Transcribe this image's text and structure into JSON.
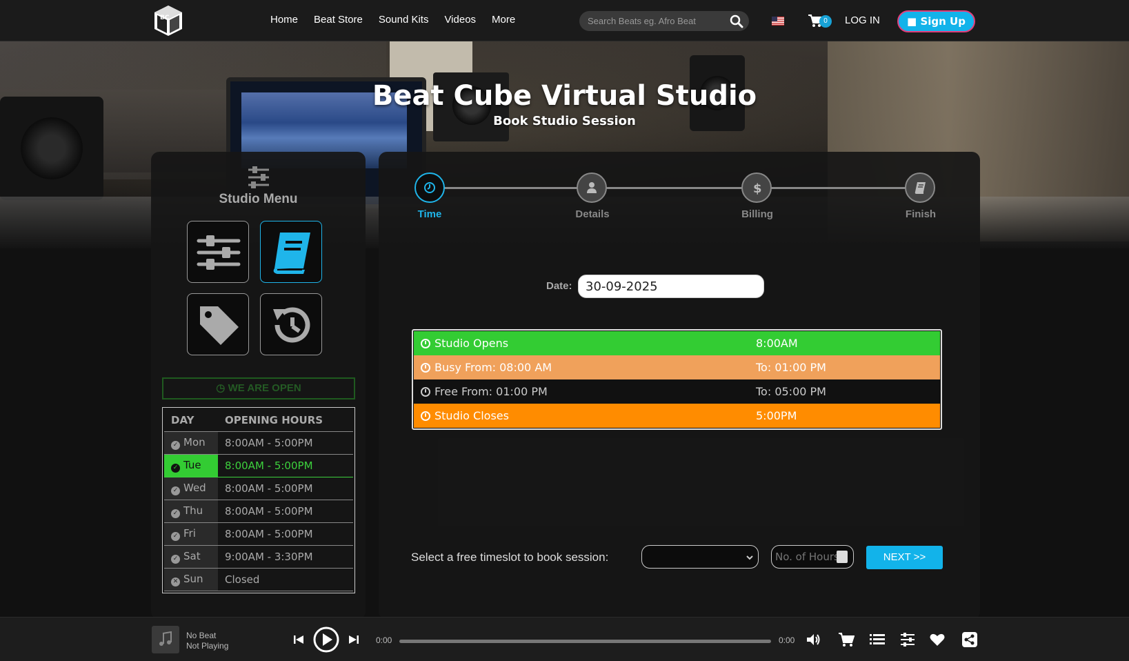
{
  "header": {
    "logo_alt": "BC",
    "nav": [
      "Home",
      "Beat Store",
      "Sound Kits",
      "Videos",
      "More"
    ],
    "search_placeholder": "Search Beats eg. Afro Beat",
    "cart_count": "0",
    "login": "LOG IN",
    "signup": "Sign Up"
  },
  "hero": {
    "title": "Beat Cube Virtual Studio",
    "subtitle": "Book Studio Session"
  },
  "sidebar": {
    "title": "Studio Menu",
    "status": "WE ARE OPEN",
    "hours_headers": [
      "DAY",
      "OPENING HOURS"
    ],
    "hours": [
      {
        "day": "Mon",
        "hours": "8:00AM - 5:00PM",
        "today": false,
        "open": true
      },
      {
        "day": "Tue",
        "hours": "8:00AM - 5:00PM",
        "today": true,
        "open": true
      },
      {
        "day": "Wed",
        "hours": "8:00AM - 5:00PM",
        "today": false,
        "open": true
      },
      {
        "day": "Thu",
        "hours": "8:00AM - 5:00PM",
        "today": false,
        "open": true
      },
      {
        "day": "Fri",
        "hours": "8:00AM - 5:00PM",
        "today": false,
        "open": true
      },
      {
        "day": "Sat",
        "hours": "9:00AM - 3:30PM",
        "today": false,
        "open": true
      },
      {
        "day": "Sun",
        "hours": "Closed",
        "today": false,
        "open": false
      }
    ]
  },
  "booking": {
    "steps": [
      "Time",
      "Details",
      "Billing",
      "Finish"
    ],
    "active_step": "Time",
    "date_label": "Date:",
    "date_value": "30-09-2025",
    "slots": [
      {
        "left": "Studio Opens",
        "right": "8:00AM",
        "kind": "open"
      },
      {
        "left": "Busy From: 08:00 AM",
        "right": "To: 01:00 PM",
        "kind": "busy"
      },
      {
        "left": "Free From: 01:00 PM",
        "right": "To: 05:00 PM",
        "kind": "free"
      },
      {
        "left": "Studio Closes",
        "right": "5:00PM",
        "kind": "close"
      }
    ],
    "select_label": "Select a free timeslot to book session:",
    "hours_placeholder": "No. of Hours",
    "next_label": "NEXT >>"
  },
  "player": {
    "title": "No Beat",
    "status": "Not Playing",
    "time_current": "0:00",
    "time_total": "0:00",
    "progress": 0
  },
  "colors": {
    "accent": "#12b3ea",
    "open": "#33cc33",
    "busy": "#f0a15b",
    "close": "#ff8c00"
  }
}
